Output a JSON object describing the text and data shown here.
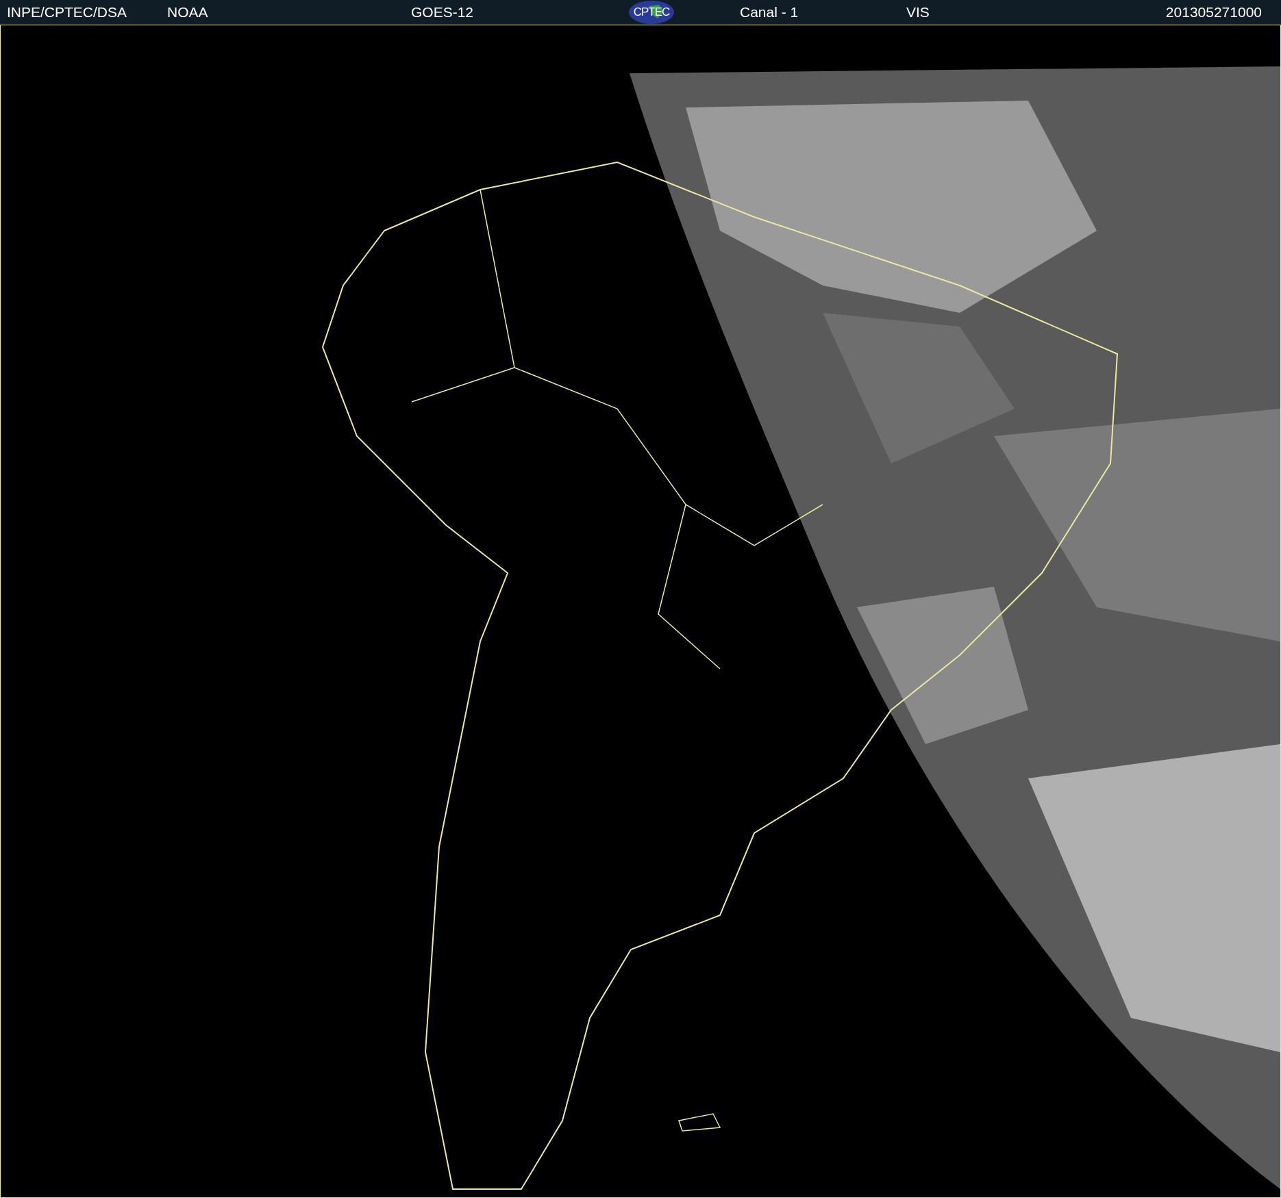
{
  "header": {
    "items": [
      {
        "kind": "text",
        "text": "INPE/CPTEC/DSA"
      },
      {
        "kind": "text",
        "text": "NOAA"
      },
      {
        "kind": "text",
        "text": "GOES-12"
      },
      {
        "kind": "logo",
        "text": "CPTEC"
      },
      {
        "kind": "text",
        "text": "Canal - 1"
      },
      {
        "kind": "text",
        "text": "VIS"
      },
      {
        "kind": "text",
        "text": "201305271000"
      }
    ]
  }
}
